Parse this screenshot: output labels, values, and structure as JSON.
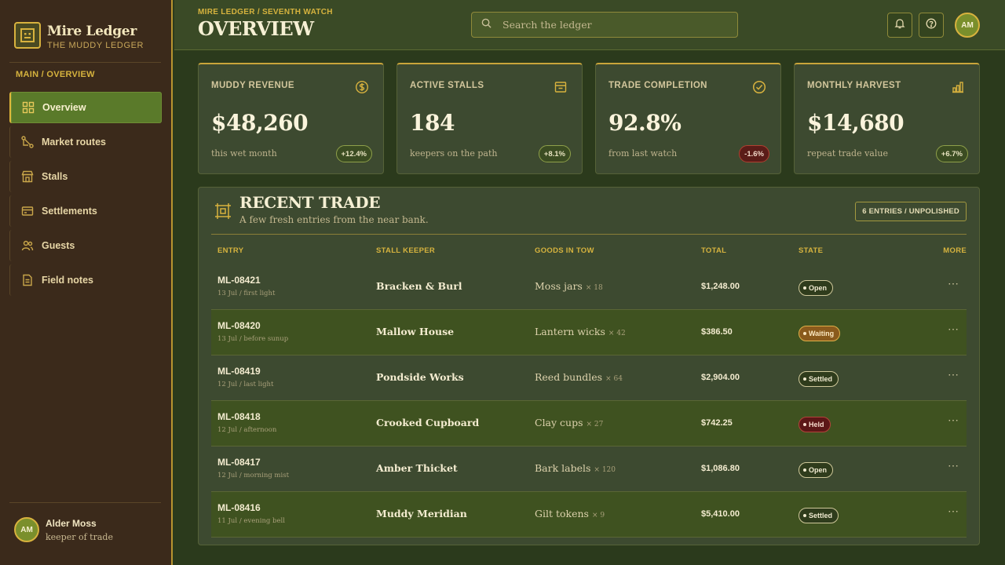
{
  "brand": {
    "title": "Mire Ledger",
    "subtitle": "THE MUDDY LEDGER"
  },
  "sidebar": {
    "crumb": "MAIN / OVERVIEW",
    "items": [
      {
        "label": "Overview",
        "icon": "grid-icon",
        "active": true
      },
      {
        "label": "Market routes",
        "icon": "route-icon"
      },
      {
        "label": "Stalls",
        "icon": "stall-icon"
      },
      {
        "label": "Settlements",
        "icon": "settlements-icon"
      },
      {
        "label": "Guests",
        "icon": "guests-icon"
      },
      {
        "label": "Field notes",
        "icon": "notes-icon"
      }
    ],
    "user": {
      "initials": "AM",
      "name": "Alder Moss",
      "role": "keeper of trade"
    }
  },
  "header": {
    "crumb": "MIRE LEDGER / SEVENTH WATCH",
    "title": "OVERVIEW",
    "search_placeholder": "Search the ledger",
    "avatar_initials": "AM"
  },
  "stats": [
    {
      "label": "MUDDY REVENUE",
      "icon": "dollar-icon",
      "value": "$48,260",
      "note": "this wet month",
      "delta": "+12.4%",
      "trend": "up"
    },
    {
      "label": "ACTIVE STALLS",
      "icon": "stall-box-icon",
      "value": "184",
      "note": "keepers on the path",
      "delta": "+8.1%",
      "trend": "up"
    },
    {
      "label": "TRADE COMPLETION",
      "icon": "check-circle-icon",
      "value": "92.8%",
      "note": "from last watch",
      "delta": "-1.6%",
      "trend": "down"
    },
    {
      "label": "MONTHLY HARVEST",
      "icon": "bar-chart-icon",
      "value": "$14,680",
      "note": "repeat trade value",
      "delta": "+6.7%",
      "trend": "up"
    }
  ],
  "recent": {
    "title": "RECENT TRADE",
    "subtitle": "A few fresh entries from the near bank.",
    "badge": "6 ENTRIES / UNPOLISHED",
    "columns": [
      "ENTRY",
      "STALL KEEPER",
      "GOODS IN TOW",
      "TOTAL",
      "STATE",
      "MORE"
    ],
    "rows": [
      {
        "id": "ML-08421",
        "when": "13 Jul / first light",
        "keeper": "Bracken & Burl",
        "goods": "Moss jars",
        "qty": "× 18",
        "total": "$1,248.00",
        "state": "Open"
      },
      {
        "id": "ML-08420",
        "when": "13 Jul / before sunup",
        "keeper": "Mallow House",
        "goods": "Lantern wicks",
        "qty": "× 42",
        "total": "$386.50",
        "state": "Waiting"
      },
      {
        "id": "ML-08419",
        "when": "12 Jul / last light",
        "keeper": "Pondside Works",
        "goods": "Reed bundles",
        "qty": "× 64",
        "total": "$2,904.00",
        "state": "Settled"
      },
      {
        "id": "ML-08418",
        "when": "12 Jul / afternoon",
        "keeper": "Crooked Cupboard",
        "goods": "Clay cups",
        "qty": "× 27",
        "total": "$742.25",
        "state": "Held"
      },
      {
        "id": "ML-08417",
        "when": "12 Jul / morning mist",
        "keeper": "Amber Thicket",
        "goods": "Bark labels",
        "qty": "× 120",
        "total": "$1,086.80",
        "state": "Open"
      },
      {
        "id": "ML-08416",
        "when": "11 Jul / evening bell",
        "keeper": "Muddy Meridian",
        "goods": "Gilt tokens",
        "qty": "× 9",
        "total": "$5,410.00",
        "state": "Settled"
      }
    ]
  },
  "colors": {
    "accent": "#d6b33e",
    "active_nav": "#5a7a2a",
    "sidebar_bg": "#3b2a1b",
    "page_bg": "#2b3a1c"
  }
}
